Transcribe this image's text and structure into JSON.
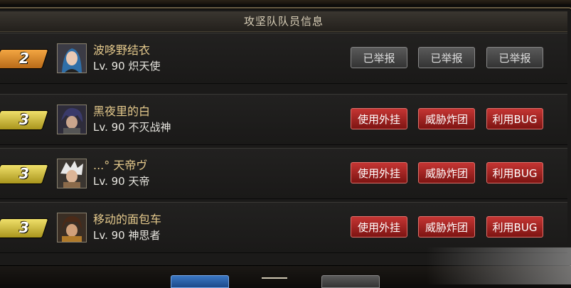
{
  "dialog": {
    "title": "攻坚队队员信息"
  },
  "members": [
    {
      "rank": "2",
      "rank_color": "orange",
      "name": "波哆野结衣",
      "level": "Lv. 90",
      "class": "炽天使",
      "actions": [
        {
          "label": "已举报",
          "style": "reported"
        },
        {
          "label": "已举报",
          "style": "reported"
        },
        {
          "label": "已举报",
          "style": "reported"
        }
      ]
    },
    {
      "rank": "3",
      "rank_color": "yellow",
      "name": "黑夜里的白",
      "level": "Lv. 90",
      "class": "不灭战神",
      "actions": [
        {
          "label": "使用外挂",
          "style": "report"
        },
        {
          "label": "威胁炸团",
          "style": "report"
        },
        {
          "label": "利用BUG",
          "style": "report"
        }
      ]
    },
    {
      "rank": "3",
      "rank_color": "yellow",
      "name": "...° 天帝ヴ",
      "level": "Lv. 90",
      "class": "天帝",
      "actions": [
        {
          "label": "使用外挂",
          "style": "report"
        },
        {
          "label": "威胁炸团",
          "style": "report"
        },
        {
          "label": "利用BUG",
          "style": "report"
        }
      ]
    },
    {
      "rank": "3",
      "rank_color": "yellow",
      "name": "移动的面包车",
      "level": "Lv. 90",
      "class": "神思者",
      "actions": [
        {
          "label": "使用外挂",
          "style": "report"
        },
        {
          "label": "威胁炸团",
          "style": "report"
        },
        {
          "label": "利用BUG",
          "style": "report"
        }
      ]
    }
  ],
  "colors": {
    "gold_text": "#e4c98c",
    "report_red": "#c53533",
    "reported_gray": "#5a5a5a",
    "frame": "#6b5e45"
  },
  "icons": {
    "portraits": [
      "portrait-icon-blue-hair",
      "portrait-icon-dark-hair",
      "portrait-icon-white-hair",
      "portrait-icon-brown-hair"
    ]
  }
}
